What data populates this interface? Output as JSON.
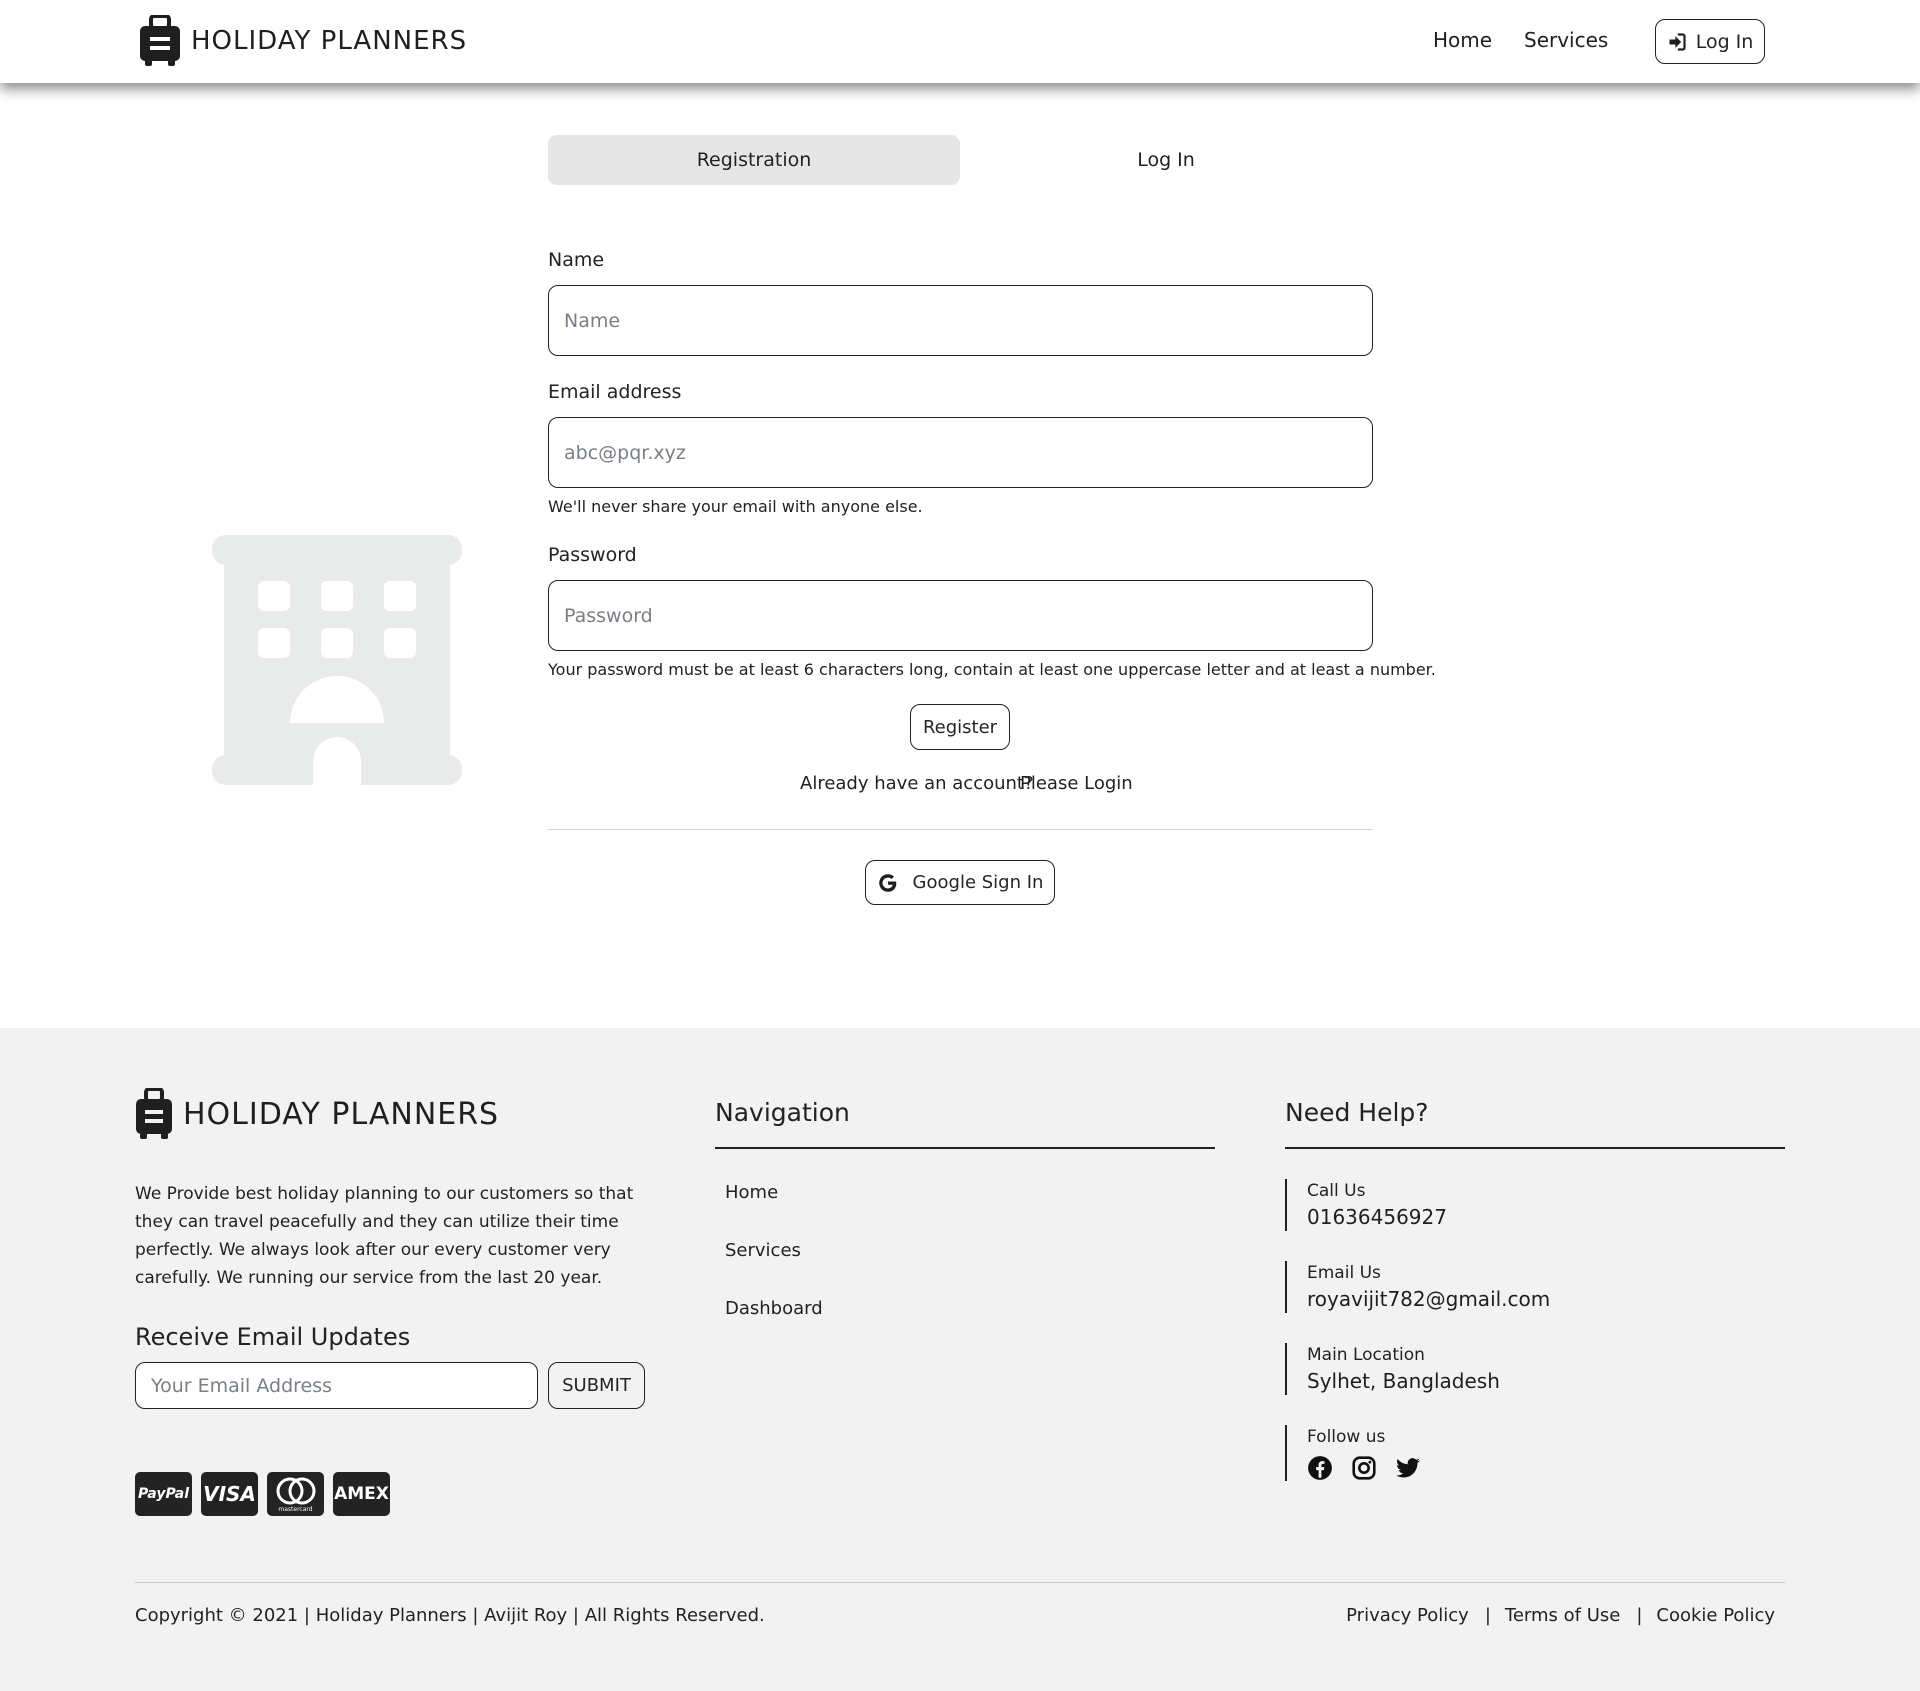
{
  "header": {
    "brand": "HOLIDAY PLANNERS",
    "nav": [
      "Home",
      "Services"
    ],
    "login_label": "Log In"
  },
  "tabs": {
    "registration": "Registration",
    "login": "Log In"
  },
  "form": {
    "name_label": "Name",
    "name_placeholder": "Name",
    "email_label": "Email address",
    "email_placeholder": "abc@pqr.xyz",
    "email_help": "We'll never share your email with anyone else.",
    "password_label": "Password",
    "password_placeholder": "Password",
    "password_help": "Your password must be at least 6 characters long, contain at least one uppercase letter and at least a number.",
    "register_label": "Register",
    "already_text": "Already have an account?",
    "please_login": "Please Login",
    "google_label": "Google Sign In"
  },
  "footer": {
    "brand": "HOLIDAY PLANNERS",
    "about": "We Provide best holiday planning to our customers so that they can travel peacefully and they can utilize their time perfectly. We always look after our every customer very carefully. We running our service from the last 20 year.",
    "updates_title": "Receive Email Updates",
    "email_placeholder": "Your Email Address",
    "submit_label": "SUBMIT",
    "payment_cards": [
      "PayPal",
      "VISA",
      "mastercard",
      "AMEX"
    ],
    "navigation_title": "Navigation",
    "navigation_items": [
      "Home",
      "Services",
      "Dashboard"
    ],
    "help_title": "Need Help?",
    "contacts": [
      {
        "label": "Call Us",
        "value": "01636456927"
      },
      {
        "label": "Email Us",
        "value": "royavijit782@gmail.com"
      },
      {
        "label": "Main Location",
        "value": "Sylhet, Bangladesh"
      }
    ],
    "follow_label": "Follow us",
    "social_icons": [
      "facebook-icon",
      "instagram-icon",
      "twitter-icon"
    ],
    "copyright": "Copyright © 2021 | Holiday Planners | Avijit Roy | All Rights Reserved.",
    "policies": [
      "Privacy Policy",
      "Terms of Use",
      "Cookie Policy"
    ]
  },
  "colors": {
    "text": "#212529",
    "footer_bg": "#f2f2f2",
    "active_tab_bg": "#e6e6e6",
    "illustration": "#e9eaea"
  }
}
